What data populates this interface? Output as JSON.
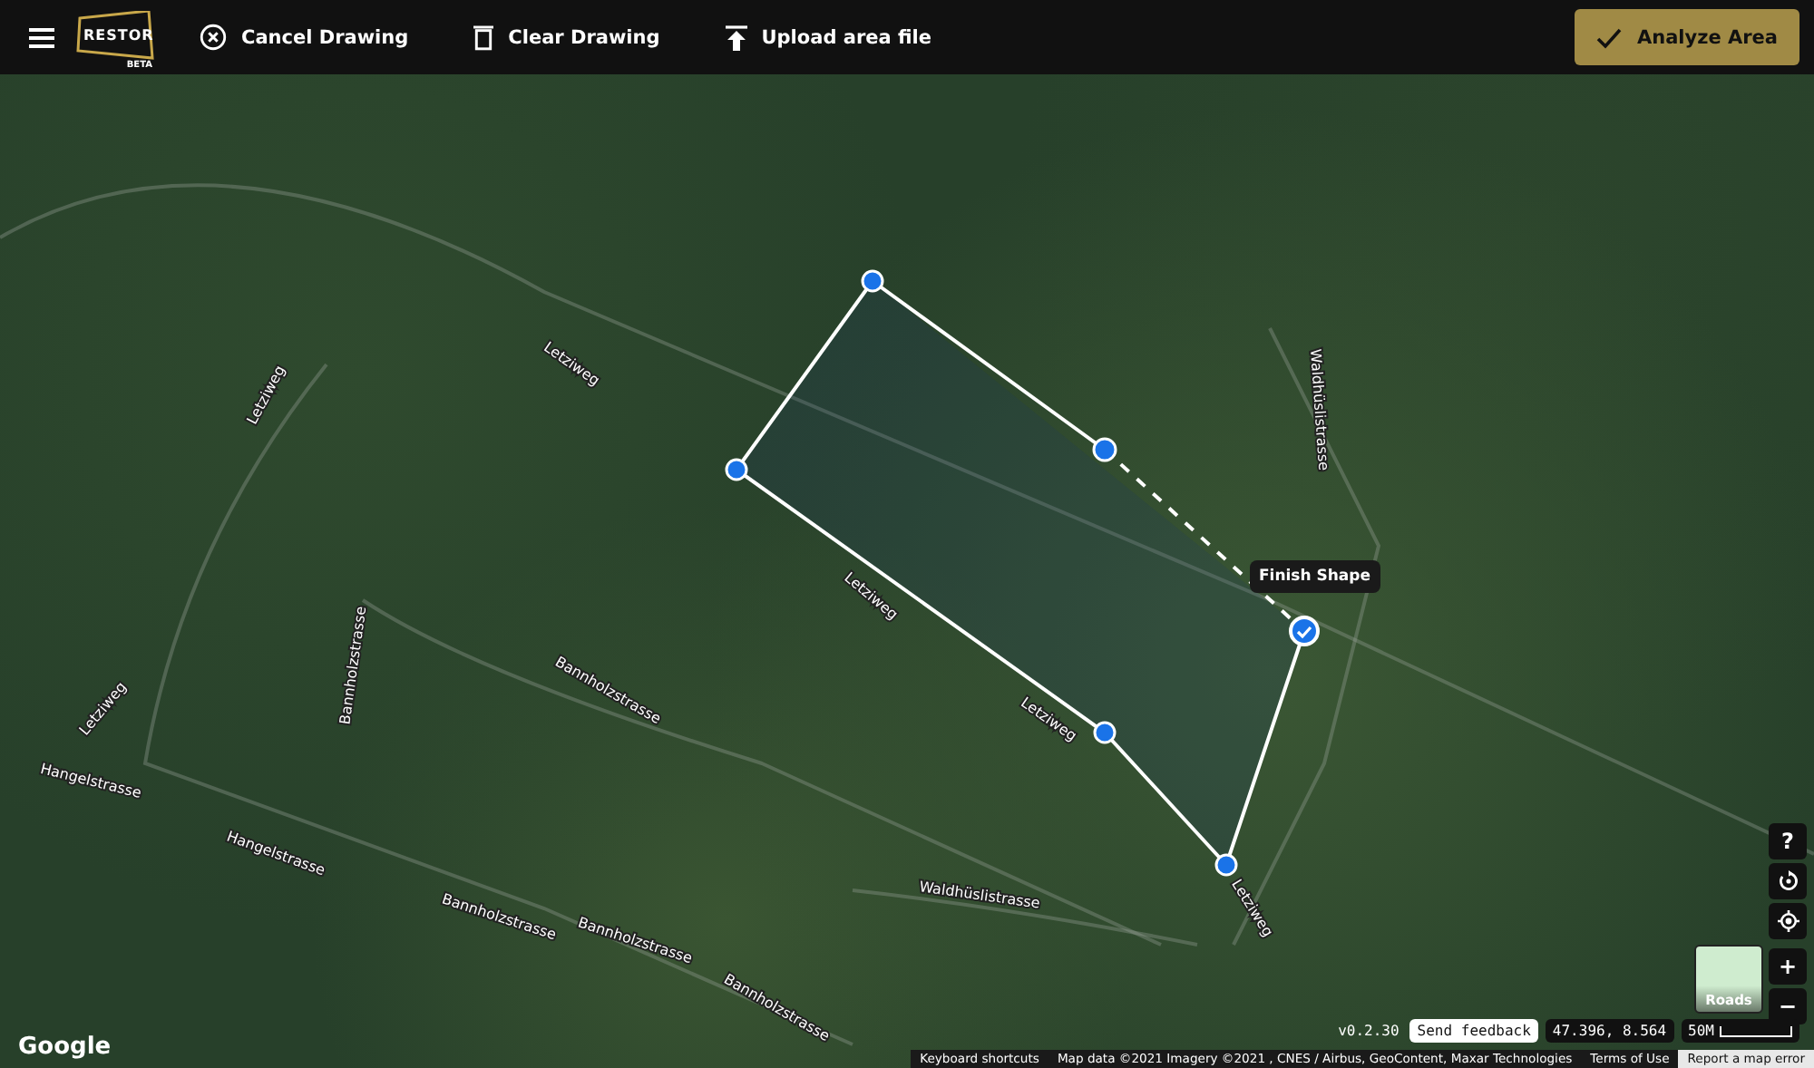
{
  "toolbar": {
    "logo": {
      "name": "RESTOR",
      "badge": "BETA"
    },
    "actions": [
      {
        "label": "Cancel Drawing",
        "kind": "cancel"
      },
      {
        "label": "Clear Drawing",
        "kind": "clear"
      },
      {
        "label": "Upload area file",
        "kind": "upload"
      }
    ],
    "primary_button": "Analyze Area"
  },
  "map": {
    "road_labels": [
      "Letziweg",
      "Letziweg",
      "Letziweg",
      "Bannholzstrasse",
      "Bannholzstrasse",
      "Hangelstrasse",
      "Hangelstrasse",
      "Bannholzstrasse",
      "Bannholzstrasse",
      "Bannholzstrasse",
      "Letziweg",
      "Letziweg",
      "Letziweg",
      "Waldhüslistrasse",
      "Waldhüslistrasse"
    ],
    "tooltip": "Finish Shape",
    "controls": [
      {
        "kind": "help",
        "label": "?"
      },
      {
        "kind": "rotate"
      },
      {
        "kind": "locate"
      },
      {
        "kind": "zoom_in",
        "label": "+"
      },
      {
        "kind": "zoom_out",
        "label": "−"
      }
    ],
    "layer_toggle": "Roads",
    "version": "v0.2.30",
    "feedback_button": "Send feedback",
    "coordinates": "47.396, 8.564",
    "scale": "50M",
    "provider": "Google",
    "attribution": [
      "Keyboard shortcuts",
      "Map data ©2021 Imagery ©2021 , CNES / Airbus, GeoContent, Maxar Technologies",
      "Terms of Use",
      "Report a map error"
    ]
  }
}
